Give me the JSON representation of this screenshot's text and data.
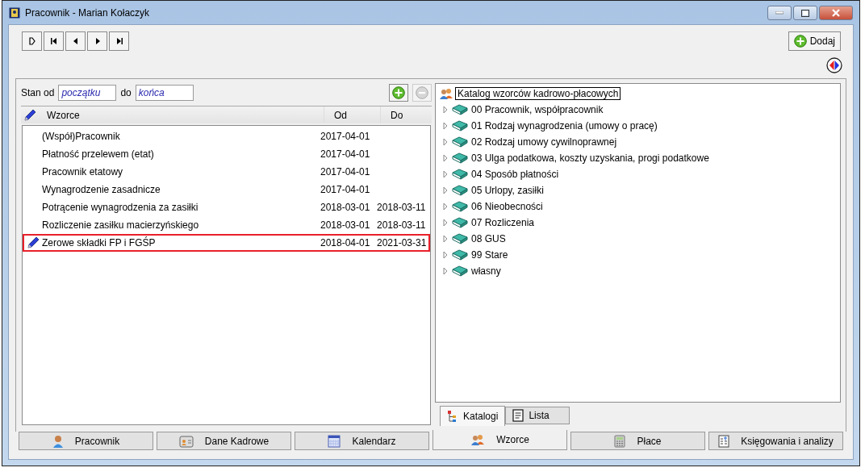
{
  "window": {
    "title": "Pracownik - Marian Kołaczyk"
  },
  "nav_buttons": [
    {
      "kind": "new"
    },
    {
      "kind": "first"
    },
    {
      "kind": "prev"
    },
    {
      "kind": "next"
    },
    {
      "kind": "last"
    }
  ],
  "add_button": {
    "label": "Dodaj"
  },
  "filter": {
    "label_from": "Stan od",
    "from": "początku",
    "label_to": "do",
    "to": "końca"
  },
  "table": {
    "columns": [
      "Wzorce",
      "Od",
      "Do"
    ],
    "rows": [
      {
        "name": "(Współ)Pracownik",
        "from": "2017-04-01",
        "to": "",
        "selected": false
      },
      {
        "name": "Płatność przelewem (etat)",
        "from": "2017-04-01",
        "to": "",
        "selected": false
      },
      {
        "name": "Pracownik etatowy",
        "from": "2017-04-01",
        "to": "",
        "selected": false
      },
      {
        "name": "Wynagrodzenie zasadnicze",
        "from": "2017-04-01",
        "to": "",
        "selected": false
      },
      {
        "name": "Potrącenie wynagrodzenia za zasiłki",
        "from": "2018-03-01",
        "to": "2018-03-11",
        "selected": false
      },
      {
        "name": "Rozliczenie zasiłku macierzyńskiego",
        "from": "2018-03-01",
        "to": "2018-03-11",
        "selected": false
      },
      {
        "name": "Zerowe składki FP i FGŚP",
        "from": "2018-04-01",
        "to": "2021-03-31",
        "selected": true
      }
    ]
  },
  "tree": {
    "root": "Katalog wzorców kadrowo-płacowych",
    "items": [
      {
        "label": "00 Pracownik, współpracownik",
        "expanded": false
      },
      {
        "label": "01 Rodzaj wynagrodzenia (umowy o pracę)",
        "expanded": false
      },
      {
        "label": "02 Rodzaj umowy cywilnoprawnej",
        "expanded": false
      },
      {
        "label": "03 Ulga podatkowa, koszty uzyskania, progi podatkowe",
        "expanded": false
      },
      {
        "label": "04 Sposób płatności",
        "expanded": false
      },
      {
        "label": "05 Urlopy, zasiłki",
        "expanded": false
      },
      {
        "label": "06 Nieobecności",
        "expanded": false
      },
      {
        "label": "07 Rozliczenia",
        "expanded": false
      },
      {
        "label": "08 GUS",
        "expanded": false
      },
      {
        "label": "99 Stare",
        "expanded": false
      },
      {
        "label": "własny",
        "expanded": false
      }
    ]
  },
  "sub_tabs": [
    {
      "label": "Katalogi",
      "kind": "tree",
      "selected": true
    },
    {
      "label": "Lista",
      "kind": "list",
      "selected": false
    }
  ],
  "tabs": [
    {
      "label": "Pracownik",
      "kind": "person",
      "selected": false
    },
    {
      "label": "Dane Kadrowe",
      "kind": "card",
      "selected": false
    },
    {
      "label": "Kalendarz",
      "kind": "calendar",
      "selected": false
    },
    {
      "label": "Wzorce",
      "kind": "people",
      "selected": true
    },
    {
      "label": "Płace",
      "kind": "calculator",
      "selected": false
    },
    {
      "label": "Księgowania i analizy",
      "kind": "ledger",
      "selected": false
    }
  ]
}
